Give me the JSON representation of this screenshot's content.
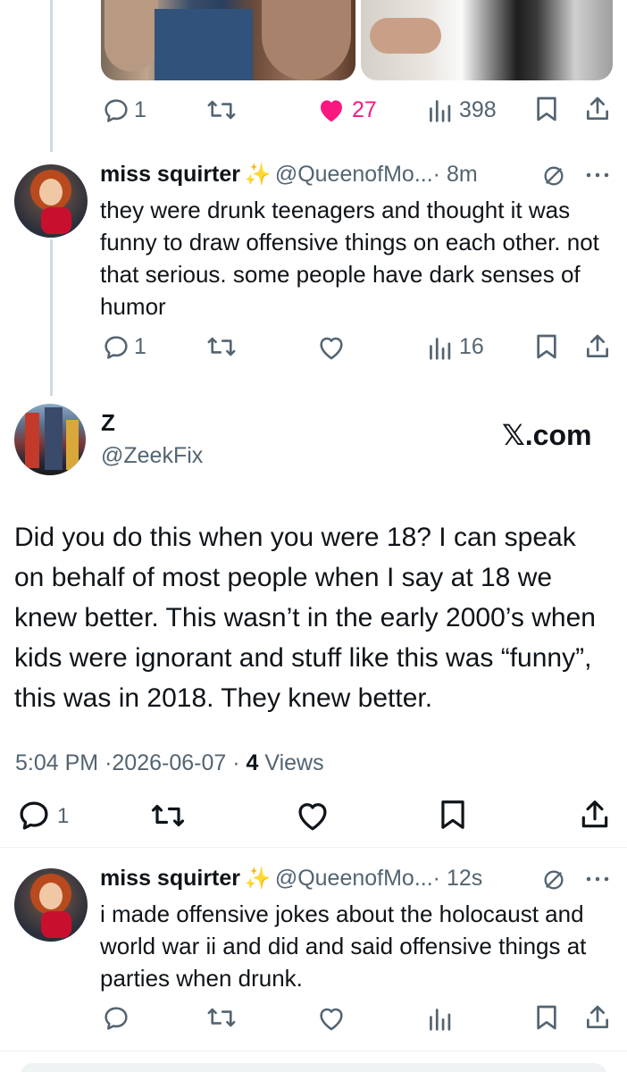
{
  "prev_tweet": {
    "actions": {
      "reply_count": "1",
      "like_count": "27",
      "views_count": "398"
    }
  },
  "reply1": {
    "name": "miss squirter",
    "sparkle": "✨",
    "handle": "@QueenofMo...",
    "time": "· 8m",
    "text": "they were drunk teenagers and thought it was funny to draw offensive things on each other. not that serious. some people have dark senses of humor",
    "actions": {
      "reply_count": "1",
      "views_count": "16"
    }
  },
  "main_tweet": {
    "name": "Z",
    "handle": "@ZeekFix",
    "watermark": "𝕏.com",
    "text": "Did you do this when you were 18? I can speak on behalf of most people when I say at 18 we knew better. This wasn’t in the early 2000’s when kids were ignorant and stuff like this was “funny”, this was in 2018. They knew better.",
    "meta": {
      "time": "5:04 PM",
      "date": "2026-06-07",
      "views": "4",
      "views_label": "Views",
      "sep": "·"
    },
    "actions": {
      "reply_count": "1"
    }
  },
  "reply2": {
    "name": "miss squirter",
    "sparkle": "✨",
    "handle": "@QueenofMo...",
    "time": "· 12s",
    "text": "i made offensive jokes about the holocaust and world war ii and did and said offensive things at parties when drunk."
  },
  "colors": {
    "like": "#f91880",
    "secondary": "#536471",
    "text": "#0f1419"
  }
}
